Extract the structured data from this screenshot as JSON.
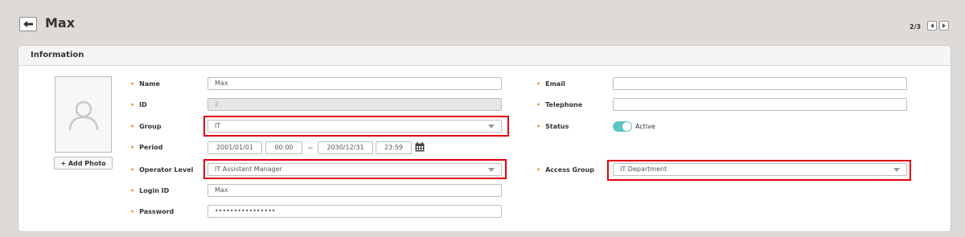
{
  "header": {
    "title": "Max",
    "pager": "2/3",
    "back_icon": "arrow-left-icon"
  },
  "panel": {
    "title": "Information"
  },
  "photo": {
    "add_label": "+ Add Photo",
    "placeholder_icon": "user-silhouette-icon"
  },
  "form": {
    "name": {
      "label": "Name",
      "value": "Max"
    },
    "id": {
      "label": "ID",
      "value": "2"
    },
    "group": {
      "label": "Group",
      "value": "IT"
    },
    "period": {
      "label": "Period",
      "start_date": "2001/01/01",
      "start_time": "00:00",
      "separator": "~",
      "end_date": "2030/12/31",
      "end_time": "23:59"
    },
    "operator_level": {
      "label": "Operator Level",
      "value": "IT Assistant Manager"
    },
    "login_id": {
      "label": "Login ID",
      "value": "Max"
    },
    "password": {
      "label": "Password",
      "value": "••••••••••••••••"
    },
    "email": {
      "label": "Email",
      "value": ""
    },
    "telephone": {
      "label": "Telephone",
      "value": ""
    },
    "status": {
      "label": "Status",
      "value": "Active",
      "on": true
    },
    "access_group": {
      "label": "Access Group",
      "value": "IT Department"
    }
  },
  "colors": {
    "highlight": "#e3000f",
    "required_dot": "#f08a24",
    "toggle_on": "#5ec4c4"
  }
}
